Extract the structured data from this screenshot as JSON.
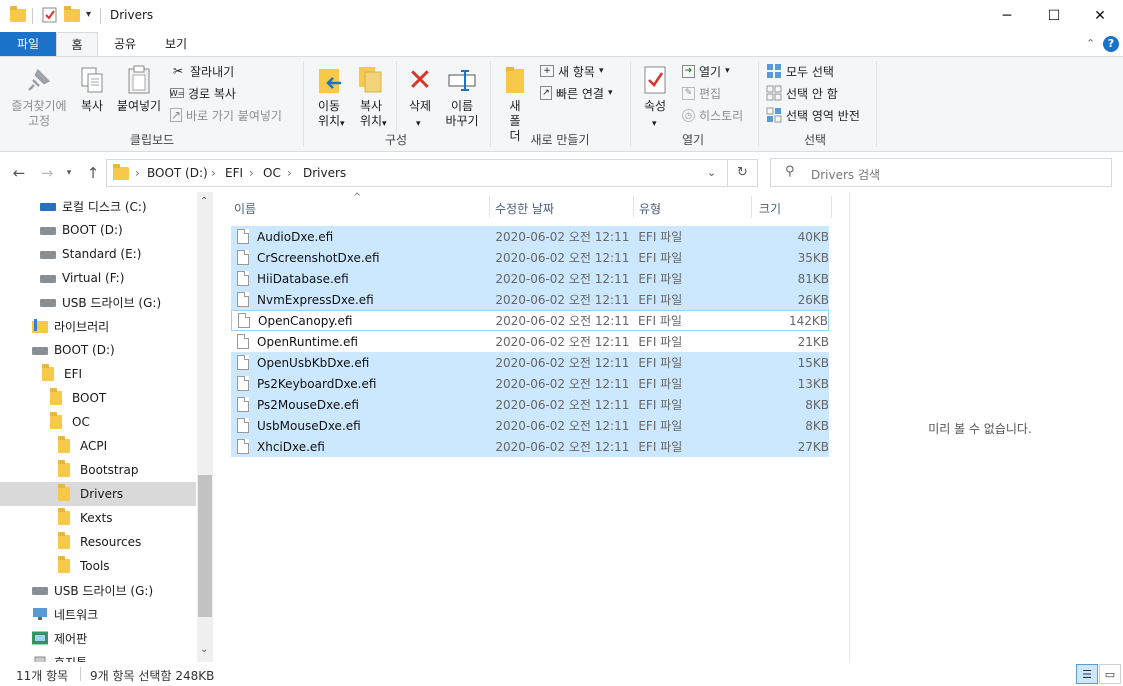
{
  "window": {
    "title": "Drivers",
    "minimize": "─",
    "maximize": "☐",
    "close": "✕"
  },
  "ribbon_tabs": {
    "file": "파일",
    "home": "홈",
    "share": "공유",
    "view": "보기"
  },
  "ribbon": {
    "clipboard": {
      "pin": "즐겨찾기에 고정",
      "copy": "복사",
      "paste": "붙여넣기",
      "cut": "잘라내기",
      "copy_path": "경로 복사",
      "paste_shortcut": "바로 가기 붙여넣기",
      "label": "클립보드"
    },
    "organize": {
      "move_to": "이동 위치",
      "copy_to": "복사 위치",
      "delete": "삭제",
      "rename": "이름 바꾸기",
      "label": "구성"
    },
    "new": {
      "new_folder": "새 폴더",
      "new_item": "새 항목",
      "easy_access": "빠른 연결",
      "label": "새로 만들기"
    },
    "open": {
      "properties": "속성",
      "open": "열기",
      "edit": "편집",
      "history": "히스토리",
      "label": "열기"
    },
    "select": {
      "select_all": "모두 선택",
      "select_none": "선택 안 함",
      "invert": "선택 영역 반전",
      "label": "선택"
    }
  },
  "address": {
    "crumbs": [
      "BOOT (D:)",
      "EFI",
      "OC",
      "Drivers"
    ],
    "search_placeholder": "Drivers 검색"
  },
  "sidebar": {
    "items": [
      {
        "label": "로컬 디스크 (C:)",
        "icon": "os-drive-icon"
      },
      {
        "label": "BOOT (D:)",
        "icon": "drive-icon"
      },
      {
        "label": "Standard (E:)",
        "icon": "drive-icon"
      },
      {
        "label": "Virtual (F:)",
        "icon": "drive-icon"
      },
      {
        "label": "USB 드라이브 (G:)",
        "icon": "drive-icon"
      },
      {
        "label": "라이브러리",
        "icon": "library-icon"
      },
      {
        "label": "BOOT (D:)",
        "icon": "drive-icon"
      },
      {
        "label": "EFI",
        "icon": "folder-icon"
      },
      {
        "label": "BOOT",
        "icon": "folder-icon"
      },
      {
        "label": "OC",
        "icon": "folder-icon"
      },
      {
        "label": "ACPI",
        "icon": "folder-icon"
      },
      {
        "label": "Bootstrap",
        "icon": "folder-icon"
      },
      {
        "label": "Drivers",
        "icon": "folder-icon"
      },
      {
        "label": "Kexts",
        "icon": "folder-icon"
      },
      {
        "label": "Resources",
        "icon": "folder-icon"
      },
      {
        "label": "Tools",
        "icon": "folder-icon"
      },
      {
        "label": "USB 드라이브 (G:)",
        "icon": "drive-icon"
      },
      {
        "label": "네트워크",
        "icon": "network-icon"
      },
      {
        "label": "제어판",
        "icon": "control-panel-icon"
      },
      {
        "label": "휴지통",
        "icon": "recycle-bin-icon"
      }
    ]
  },
  "columns": {
    "name": "이름",
    "date": "수정한 날짜",
    "type": "유형",
    "size": "크기"
  },
  "files": [
    {
      "name": "AudioDxe.efi",
      "date": "2020-06-02 오전 12:11",
      "type": "EFI 파일",
      "size": "40KB",
      "selected": true
    },
    {
      "name": "CrScreenshotDxe.efi",
      "date": "2020-06-02 오전 12:11",
      "type": "EFI 파일",
      "size": "35KB",
      "selected": true
    },
    {
      "name": "HiiDatabase.efi",
      "date": "2020-06-02 오전 12:11",
      "type": "EFI 파일",
      "size": "81KB",
      "selected": true
    },
    {
      "name": "NvmExpressDxe.efi",
      "date": "2020-06-02 오전 12:11",
      "type": "EFI 파일",
      "size": "26KB",
      "selected": true
    },
    {
      "name": "OpenCanopy.efi",
      "date": "2020-06-02 오전 12:11",
      "type": "EFI 파일",
      "size": "142KB",
      "selected": false,
      "focused": true
    },
    {
      "name": "OpenRuntime.efi",
      "date": "2020-06-02 오전 12:11",
      "type": "EFI 파일",
      "size": "21KB",
      "selected": false
    },
    {
      "name": "OpenUsbKbDxe.efi",
      "date": "2020-06-02 오전 12:11",
      "type": "EFI 파일",
      "size": "15KB",
      "selected": true
    },
    {
      "name": "Ps2KeyboardDxe.efi",
      "date": "2020-06-02 오전 12:11",
      "type": "EFI 파일",
      "size": "13KB",
      "selected": true
    },
    {
      "name": "Ps2MouseDxe.efi",
      "date": "2020-06-02 오전 12:11",
      "type": "EFI 파일",
      "size": "8KB",
      "selected": true
    },
    {
      "name": "UsbMouseDxe.efi",
      "date": "2020-06-02 오전 12:11",
      "type": "EFI 파일",
      "size": "8KB",
      "selected": true
    },
    {
      "name": "XhciDxe.efi",
      "date": "2020-06-02 오전 12:11",
      "type": "EFI 파일",
      "size": "27KB",
      "selected": true
    }
  ],
  "preview": {
    "message": "미리 볼 수 없습니다."
  },
  "status": {
    "count": "11개 항목",
    "selected": "9개 항목 선택함 248KB"
  },
  "colors": {
    "accent": "#1a73c8",
    "selection": "#cce8ff",
    "folder": "#f7c948"
  }
}
